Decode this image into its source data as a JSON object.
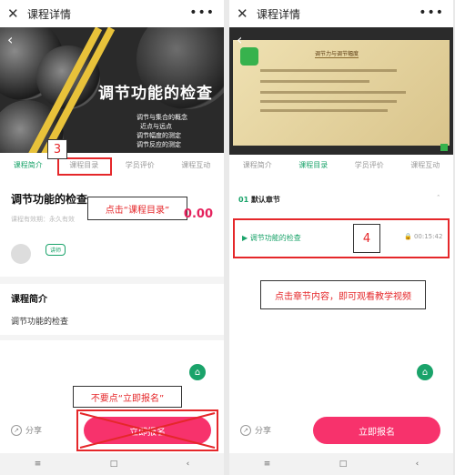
{
  "topbar": {
    "title": "课程详情",
    "close_glyph": "✕",
    "more_glyph": "•••"
  },
  "left": {
    "banner": {
      "title": "调节功能的检查",
      "bullets": [
        "调节与集合的概念",
        "近点与远点",
        "调节幅度的测定",
        "调节反应的测定"
      ]
    },
    "tabs": [
      "课程简介",
      "课程目录",
      "学员评价",
      "课程互动"
    ],
    "active_tab": 0,
    "step_label": "3",
    "course_title": "调节功能的检查",
    "course_meta": "课程有效期：永久有效",
    "price": "0.00",
    "badge": "讲师",
    "callout_catalog": "点击“课程目录”",
    "intro_heading": "课程简介",
    "intro_text": "调节功能的检查",
    "callout_no_enroll": "不要点“立即报名”",
    "share_label": "分享",
    "enroll_label": "立即报名"
  },
  "right": {
    "tabs": [
      "课程简介",
      "课程目录",
      "学员评价",
      "课程互动"
    ],
    "active_tab": 1,
    "slide_title": "调节力与调节幅度",
    "chapter_num": "01",
    "chapter_name": "默认章节",
    "lesson_title": "调节功能的检查",
    "duration": "00:15:42",
    "step_label": "4",
    "callout_click_lesson": "点击章节内容，即可观看教学视频",
    "share_label": "分享",
    "enroll_label": "立即报名"
  },
  "navbar": {
    "menu": "≡",
    "home": "□",
    "back": "‹"
  },
  "colors": {
    "accent_green": "#1aa36a",
    "highlight_red": "#e5272a",
    "enroll_pink": "#f7326c"
  }
}
